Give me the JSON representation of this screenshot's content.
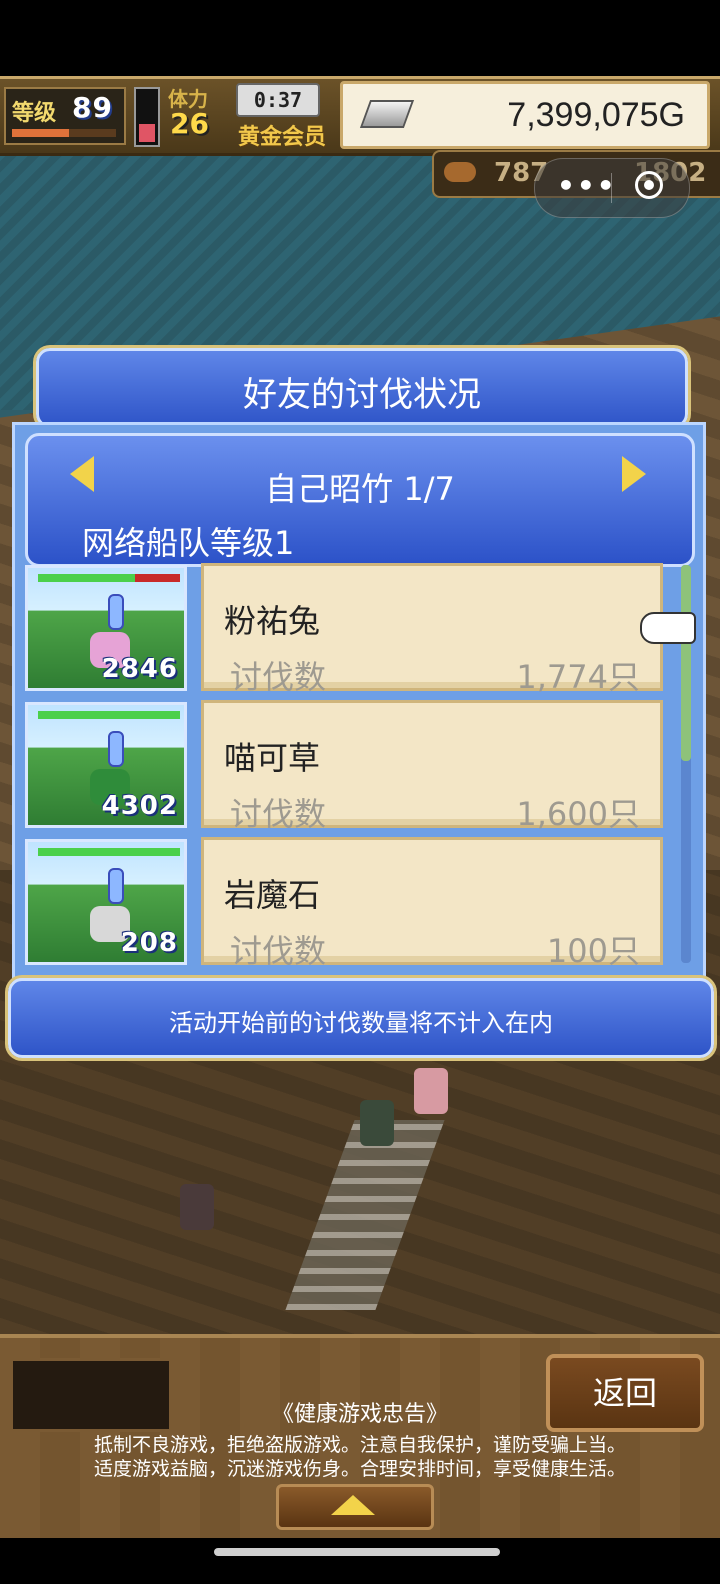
{
  "hud": {
    "level_label": "等级",
    "level_value": "89",
    "stamina_label": "体力",
    "stamina_value": "26",
    "timer": "0:37",
    "vip_label": "黄金会员",
    "gold_value": "7,399,075G",
    "resource_1": "787",
    "resource_2": "1802"
  },
  "mini_program": {
    "more_icon": "more-dots-icon",
    "close_icon": "target-icon",
    "more_text": "•••"
  },
  "dialog": {
    "title": "好友的讨伐状况",
    "friend_name": "自己昭竹 1/7",
    "fleet_level": "网络船队等级1",
    "rows": [
      {
        "power": "2846",
        "monster": "粉祐兔",
        "kill_label": "讨伐数",
        "kill_value": "1,774只",
        "hp_ratio": 0.68
      },
      {
        "power": "4302",
        "monster": "喵可草",
        "kill_label": "讨伐数",
        "kill_value": "1,600只",
        "hp_ratio": 1.0
      },
      {
        "power": "208",
        "monster": "岩魔石",
        "kill_label": "讨伐数",
        "kill_value": "100只",
        "hp_ratio": 1.0
      }
    ],
    "notice": "活动开始前的讨伐数量将不计入在内"
  },
  "bottom": {
    "back_label": "返回",
    "health_title": "《健康游戏忠告》",
    "health_line1": "抵制不良游戏，拒绝盗版游戏。注意自我保护，谨防受骗上当。",
    "health_line2": "适度游戏益脑，沉迷游戏伤身。合理安排时间，享受健康生活。"
  },
  "colors": {
    "panel_blue": "#2f55c8",
    "card_bg": "#f3e6c6",
    "gold_accent": "#f2d34a"
  }
}
